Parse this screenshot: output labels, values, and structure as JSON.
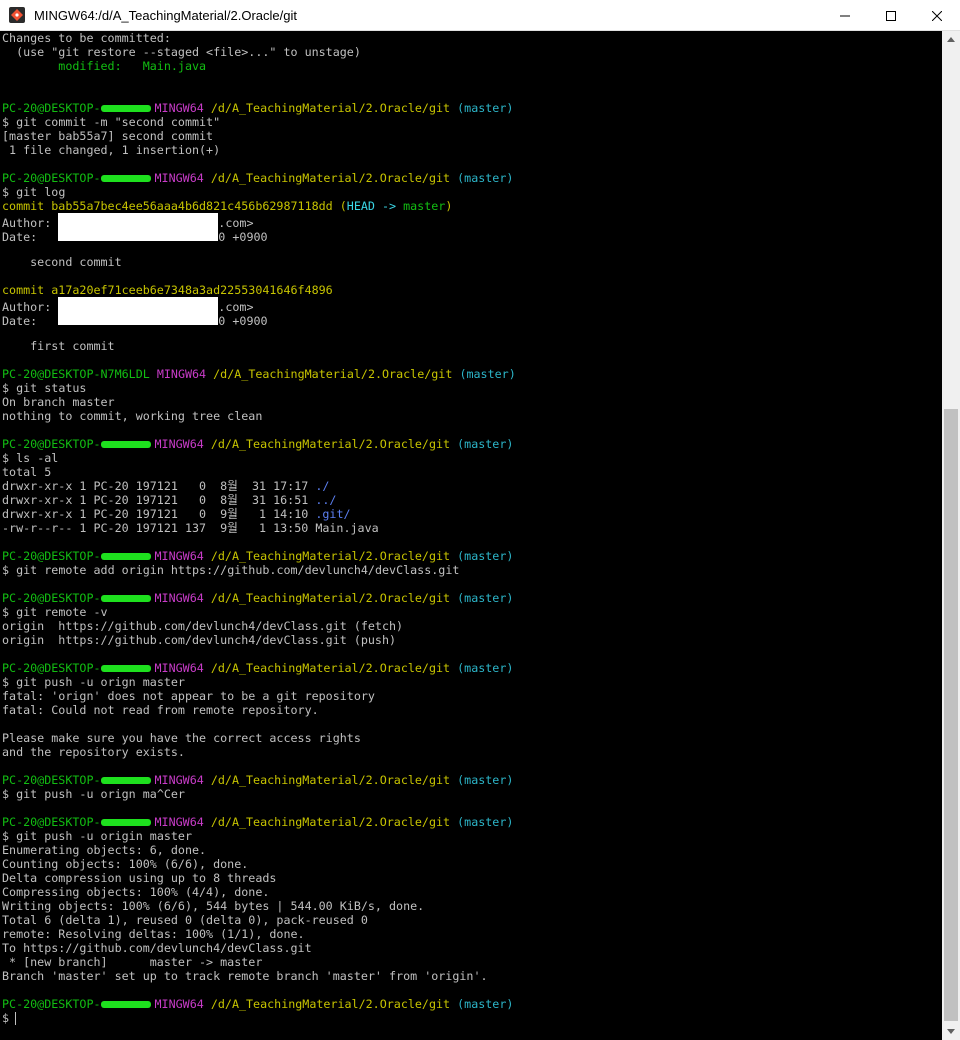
{
  "window": {
    "title": "MINGW64:/d/A_TeachingMaterial/2.Oracle/git",
    "icon": "git-bash-icon",
    "controls": {
      "minimize": "minimize-icon",
      "maximize": "maximize-icon",
      "close": "close-icon"
    }
  },
  "prompt": {
    "user_host_prefix": "PC-20@DESKTOP-",
    "user_host_full": "PC-20@DESKTOP-N7M6LDL",
    "shell": "MINGW64",
    "path": "/d/A_TeachingMaterial/2.Oracle/git",
    "branch": "(master)",
    "symbol": "$"
  },
  "terminal": {
    "l1": "Changes to be committed:",
    "l2": "  (use \"git restore --staged <file>...\" to unstage)",
    "l3": "        modified:   Main.java",
    "cmd_commit": "git commit -m \"second commit\"",
    "commit_out1": "[master bab55a7] second commit",
    "commit_out2": " 1 file changed, 1 insertion(+)",
    "cmd_log": "git log",
    "log1_commit_label": "commit bab55a7bec4ee56aaa4b6d821c456b62987118dd",
    "log1_head_open": " (",
    "log1_head": "HEAD -> ",
    "log1_master": "master",
    "log1_head_close": ")",
    "author_label": "Author: ",
    "author_tail": ".com>",
    "date_label": "Date:   ",
    "date_tail": "0 +0900",
    "log1_msg": "    second commit",
    "log2_commit": "commit a17a20ef71ceeb6e7348a3ad22553041646f4896",
    "log2_msg": "    first commit",
    "cmd_status": "git status",
    "status1": "On branch master",
    "status2": "nothing to commit, working tree clean",
    "cmd_ls": "ls -al",
    "ls_total": "total 5",
    "ls1_prefix": "drwxr-xr-x 1 PC-20 197121   0  8월  31 17:17 ",
    "ls1_name": "./",
    "ls2_prefix": "drwxr-xr-x 1 PC-20 197121   0  8월  31 16:51 ",
    "ls2_name": "../",
    "ls3_prefix": "drwxr-xr-x 1 PC-20 197121   0  9월   1 14:10 ",
    "ls3_name": ".git/",
    "ls4": "-rw-r--r-- 1 PC-20 197121 137  9월   1 13:50 Main.java",
    "cmd_remote_add": "git remote add origin https://github.com/devlunch4/devClass.git",
    "cmd_remote_v": "git remote -v",
    "remote1": "origin  https://github.com/devlunch4/devClass.git (fetch)",
    "remote2": "origin  https://github.com/devlunch4/devClass.git (push)",
    "cmd_push_bad": "git push -u orign master",
    "err1": "fatal: 'orign' does not appear to be a git repository",
    "err2": "fatal: Could not read from remote repository.",
    "err3": "Please make sure you have the correct access rights",
    "err4": "and the repository exists.",
    "cmd_push_cancel": "git push -u orign ma^Cer",
    "cmd_push_ok": "git push -u origin master",
    "p1": "Enumerating objects: 6, done.",
    "p2": "Counting objects: 100% (6/6), done.",
    "p3": "Delta compression using up to 8 threads",
    "p4": "Compressing objects: 100% (4/4), done.",
    "p5": "Writing objects: 100% (6/6), 544 bytes | 544.00 KiB/s, done.",
    "p6": "Total 6 (delta 1), reused 0 (delta 0), pack-reused 0",
    "p7": "remote: Resolving deltas: 100% (1/1), done.",
    "p8": "To https://github.com/devlunch4/devClass.git",
    "p9": " * [new branch]      master -> master",
    "p10": "Branch 'master' set up to track remote branch 'master' from 'origin'."
  },
  "colors": {
    "background": "#000000",
    "text": "#c0c0c0",
    "prompt_user": "#12bd12",
    "prompt_shell": "#c83cc8",
    "prompt_path": "#c7c400",
    "prompt_branch": "#2cb5c8",
    "directory": "#5b7ff0"
  }
}
